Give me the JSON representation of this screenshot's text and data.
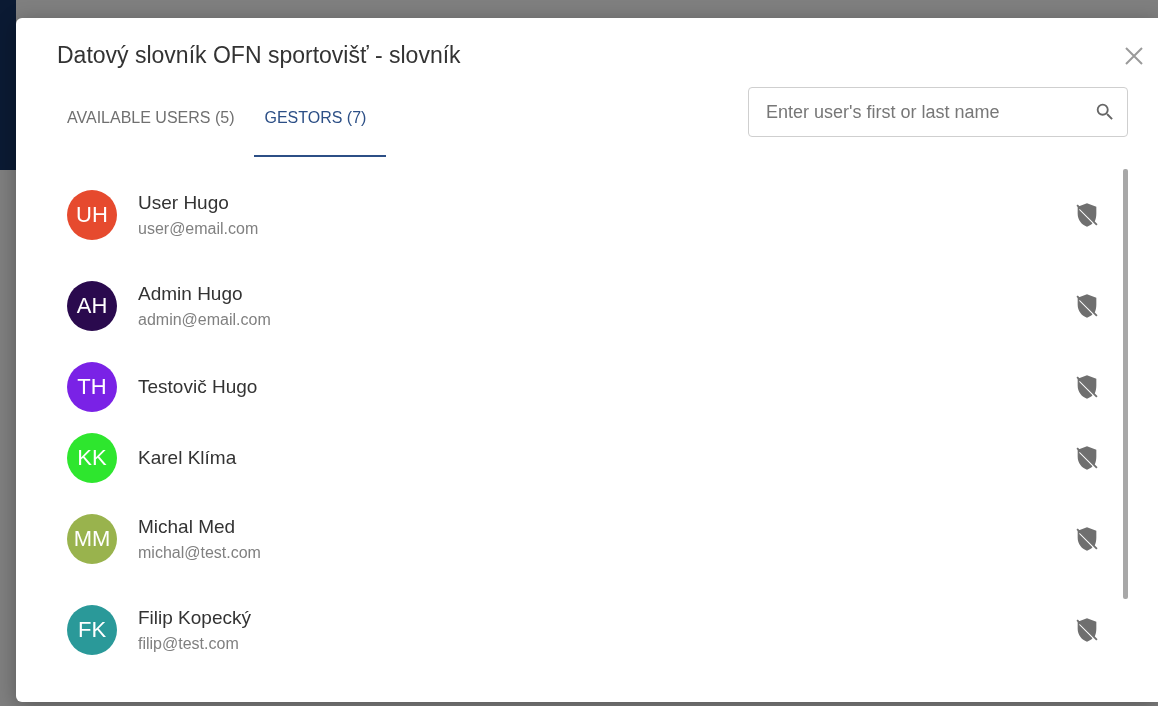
{
  "dialog": {
    "title": "Datový slovník OFN sportovišť - slovník"
  },
  "tabs": [
    {
      "label": "AVAILABLE USERS (5)",
      "selected": false
    },
    {
      "label": "GESTORS (7)",
      "selected": true
    }
  ],
  "search": {
    "placeholder": "Enter user's first or last name"
  },
  "users": [
    {
      "initials": "UH",
      "name": "User Hugo",
      "email": "user@email.com",
      "color": "#e64a2e"
    },
    {
      "initials": "AH",
      "name": "Admin Hugo",
      "email": "admin@email.com",
      "color": "#2a0a4e"
    },
    {
      "initials": "TH",
      "name": "Testovič Hugo",
      "color": "#7a22e6"
    },
    {
      "initials": "KK",
      "name": "Karel Klíma",
      "color": "#2ee62e"
    },
    {
      "initials": "MM",
      "name": "Michal Med",
      "email": "michal@test.com",
      "color": "#99b34d"
    },
    {
      "initials": "FK",
      "name": "Filip Kopecký",
      "email": "filip@test.com",
      "color": "#2a9999"
    }
  ]
}
